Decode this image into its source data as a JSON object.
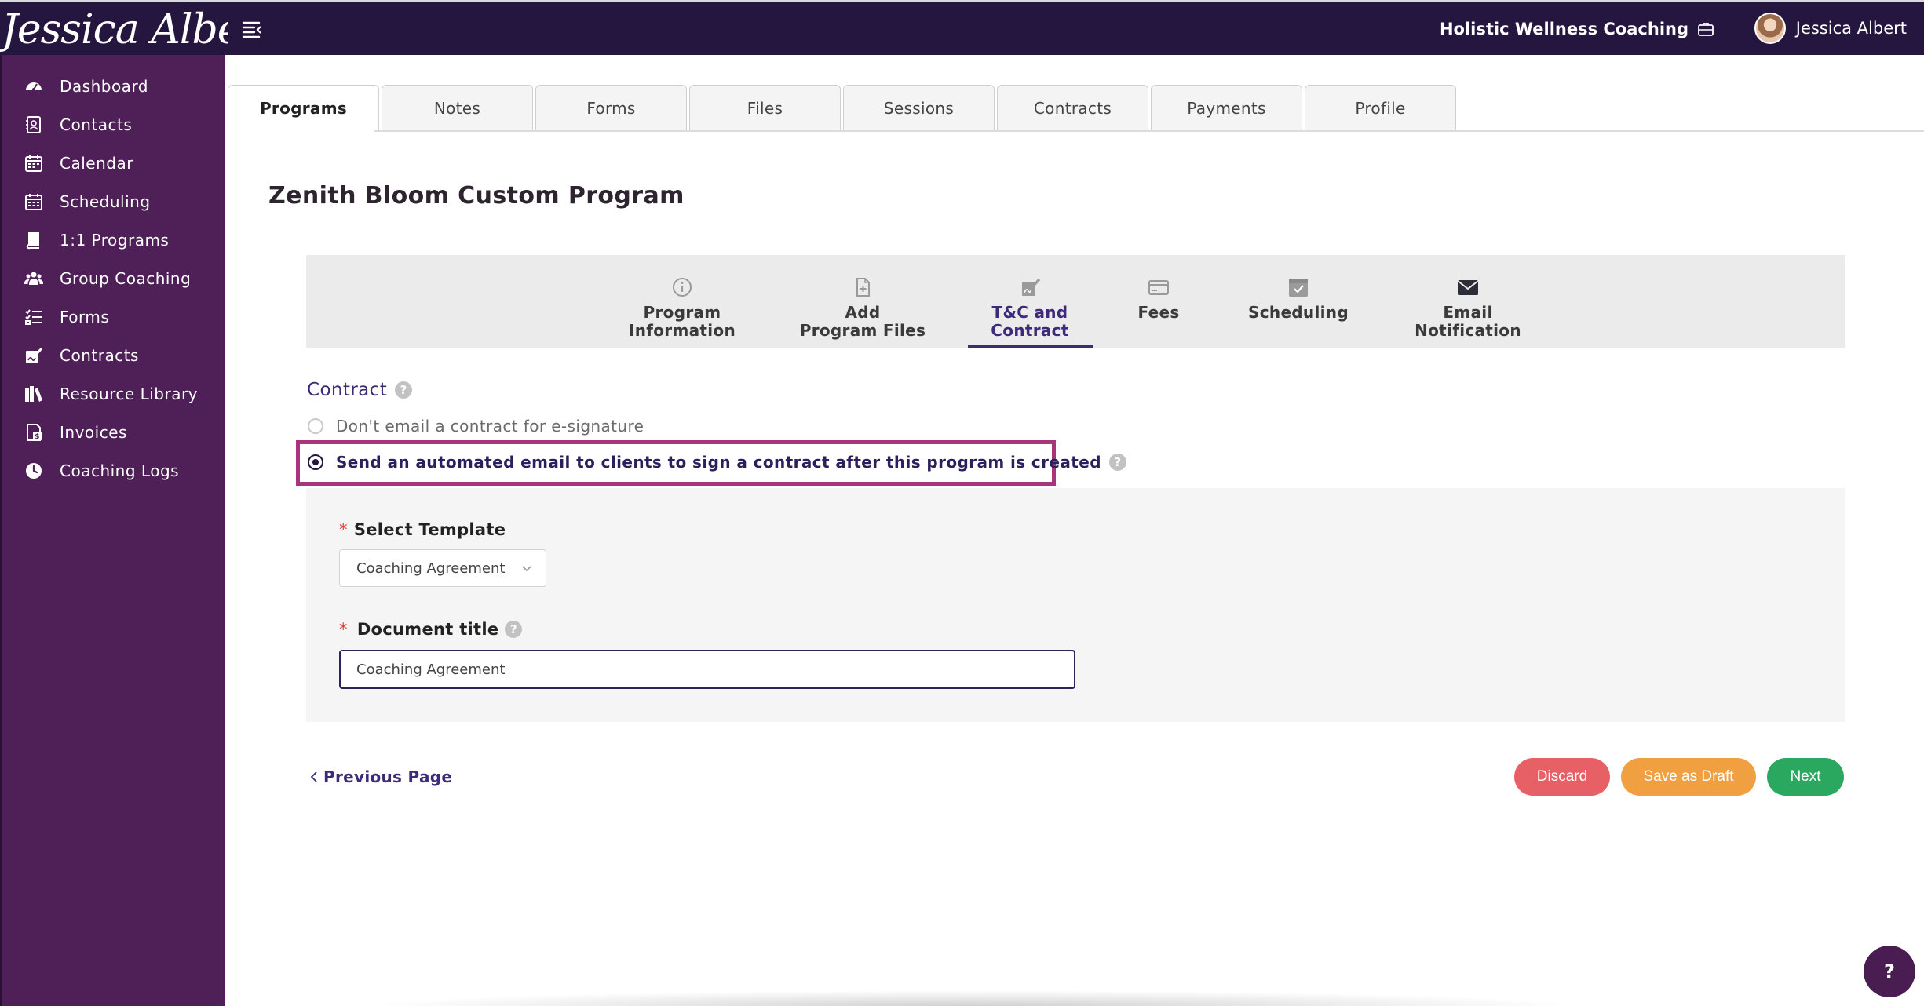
{
  "header": {
    "logo_text": "Jessica Albert",
    "business_name": "Holistic Wellness Coaching",
    "user_name": "Jessica Albert"
  },
  "sidebar": {
    "items": [
      {
        "label": "Dashboard",
        "icon": "dashboard-gauge-icon"
      },
      {
        "label": "Contacts",
        "icon": "contacts-book-icon"
      },
      {
        "label": "Calendar",
        "icon": "calendar-icon"
      },
      {
        "label": "Scheduling",
        "icon": "scheduling-calendar-icon"
      },
      {
        "label": "1:1 Programs",
        "icon": "book-icon"
      },
      {
        "label": "Group Coaching",
        "icon": "group-users-icon"
      },
      {
        "label": "Forms",
        "icon": "checklist-icon"
      },
      {
        "label": "Contracts",
        "icon": "signature-icon"
      },
      {
        "label": "Resource Library",
        "icon": "library-books-icon"
      },
      {
        "label": "Invoices",
        "icon": "invoice-icon"
      },
      {
        "label": "Coaching Logs",
        "icon": "clock-icon"
      }
    ]
  },
  "tabs": [
    "Programs",
    "Notes",
    "Forms",
    "Files",
    "Sessions",
    "Contracts",
    "Payments",
    "Profile"
  ],
  "page": {
    "title": "Zenith Bloom Custom Program"
  },
  "steps": [
    {
      "line1": "Program",
      "line2": "Information",
      "icon": "info-circle-icon"
    },
    {
      "line1": "Add",
      "line2": "Program Files",
      "icon": "file-plus-icon"
    },
    {
      "line1": "T&C and",
      "line2": "Contract",
      "icon": "contract-sign-icon"
    },
    {
      "line1": "Fees",
      "line2": "",
      "icon": "credit-card-icon"
    },
    {
      "line1": "Scheduling",
      "line2": "",
      "icon": "calendar-check-icon"
    },
    {
      "line1": "Email",
      "line2": "Notification",
      "icon": "envelope-icon"
    }
  ],
  "contract": {
    "section_label": "Contract",
    "option_no_email": "Don't email a contract for e-signature",
    "option_send_email": "Send an automated email to clients to sign a contract after this program is created",
    "select_template_label": "Select Template",
    "select_template_value": "Coaching Agreement",
    "document_title_label": "Document title",
    "document_title_value": "Coaching Agreement"
  },
  "actions": {
    "previous": "Previous Page",
    "discard": "Discard",
    "save_draft": "Save as Draft",
    "next": "Next"
  },
  "help_fab": "?",
  "colors": {
    "topbar": "#25163f",
    "sidebar": "#4f1f58",
    "accent": "#3d2a78",
    "highlight": "#a6357b",
    "discard": "#e76066",
    "draft": "#f0a040",
    "next": "#2aa860"
  }
}
